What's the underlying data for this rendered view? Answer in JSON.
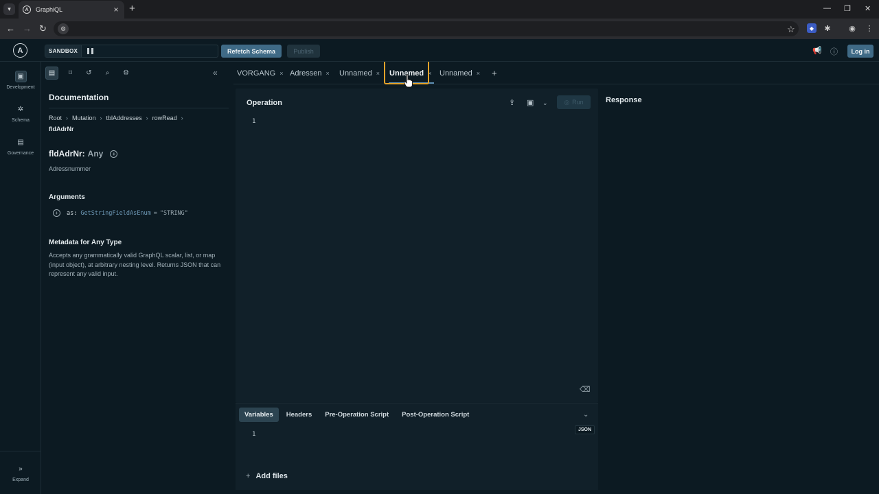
{
  "browser": {
    "tab_title": "GraphiQL",
    "tab_close": "×",
    "new_tab": "+",
    "favicon_letter": "A"
  },
  "header": {
    "sandbox_label": "SANDBOX",
    "refetch_label": "Refetch Schema",
    "publish_label": "Publish",
    "login_label": "Log in"
  },
  "rail": {
    "items": [
      {
        "label": "Development",
        "icon": "code-icon"
      },
      {
        "label": "Schema",
        "icon": "schema-icon"
      },
      {
        "label": "Governance",
        "icon": "governance-icon"
      }
    ],
    "expand_label": "Expand"
  },
  "docs": {
    "title": "Documentation",
    "breadcrumb": [
      "Root",
      "Mutation",
      "tblAddresses",
      "rowRead",
      "fldAdrNr"
    ],
    "field_name": "fldAdrNr:",
    "field_type": "Any",
    "field_description": "Adressnummer",
    "arguments_title": "Arguments",
    "argument": {
      "name": "as:",
      "type": "GetStringFieldAsEnum",
      "eq": "=",
      "default": "\"STRING\""
    },
    "metadata_title": "Metadata for Any Type",
    "metadata_description": "Accepts any grammatically valid GraphQL scalar, list, or map (input object), at arbitrary nesting level. Returns JSON that can represent any valid input."
  },
  "tabs": [
    {
      "label": "VORGANG",
      "active": false
    },
    {
      "label": "Adressen",
      "active": false
    },
    {
      "label": "Unnamed",
      "active": false
    },
    {
      "label": "Unnamed",
      "active": true
    },
    {
      "label": "Unnamed",
      "active": false
    }
  ],
  "tab_close": "×",
  "add_tab": "+",
  "operation": {
    "title": "Operation",
    "run_label": "Run",
    "line": "1"
  },
  "variables": {
    "tabs": [
      "Variables",
      "Headers",
      "Pre-Operation Script",
      "Post-Operation Script"
    ],
    "line": "1",
    "json_badge": "JSON",
    "add_files": "Add files"
  },
  "response": {
    "title": "Response"
  },
  "colors": {
    "background": "#0c1a22",
    "accent": "#3f6a86",
    "highlight": "#e3a22a"
  }
}
